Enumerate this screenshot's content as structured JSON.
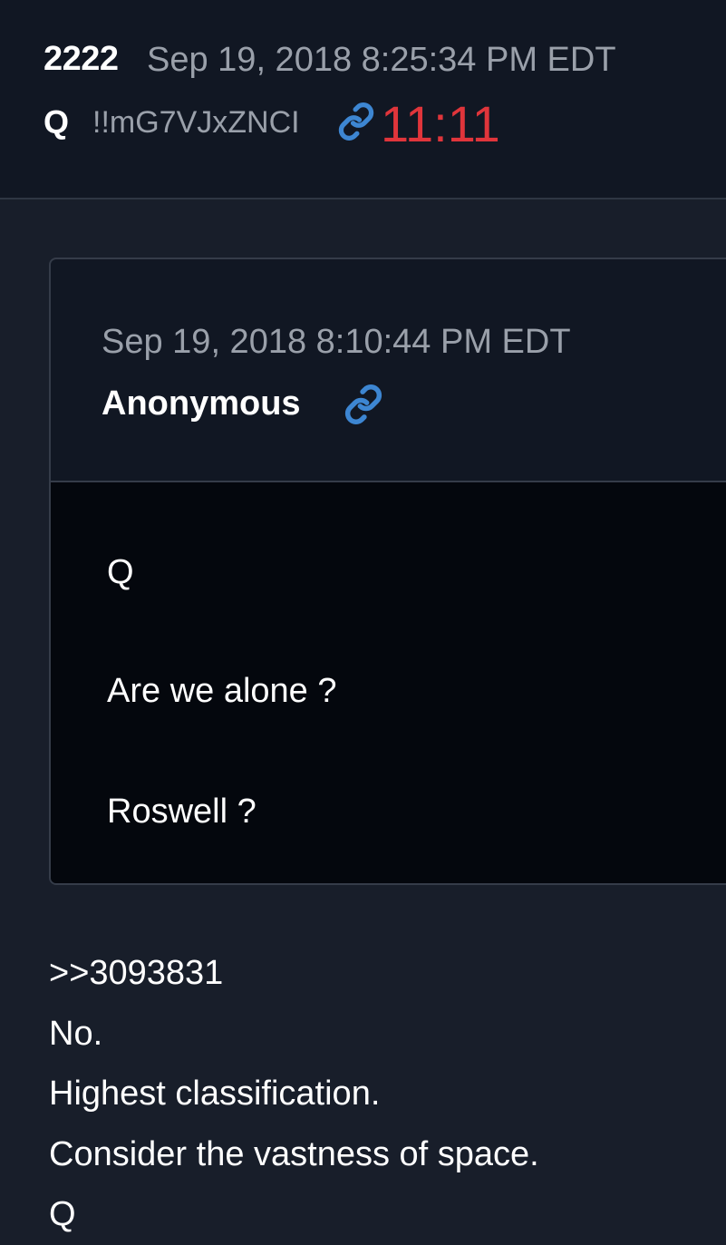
{
  "post": {
    "number": "2222",
    "timestamp": "Sep 19, 2018 8:25:34 PM EDT",
    "author": "Q",
    "tripcode": "!!mG7VJxZNCI",
    "time_badge": "11:11",
    "link_icon": "link-icon"
  },
  "quoted_post": {
    "timestamp": "Sep 19, 2018 8:10:44 PM EDT",
    "author": "Anonymous",
    "link_icon": "link-icon",
    "lines": [
      "Q",
      "Are we alone ?",
      "Roswell ?"
    ]
  },
  "reply": {
    "lines": [
      ">>3093831",
      "No.",
      "Highest classification.",
      "Consider the vastness of space.",
      "Q"
    ]
  },
  "colors": {
    "background": "#181e2a",
    "header_background": "#111723",
    "quote_body_background": "#04070d",
    "muted_text": "#9aa0aa",
    "accent_link": "#3d86d2",
    "time_badge": "#e0353b"
  }
}
